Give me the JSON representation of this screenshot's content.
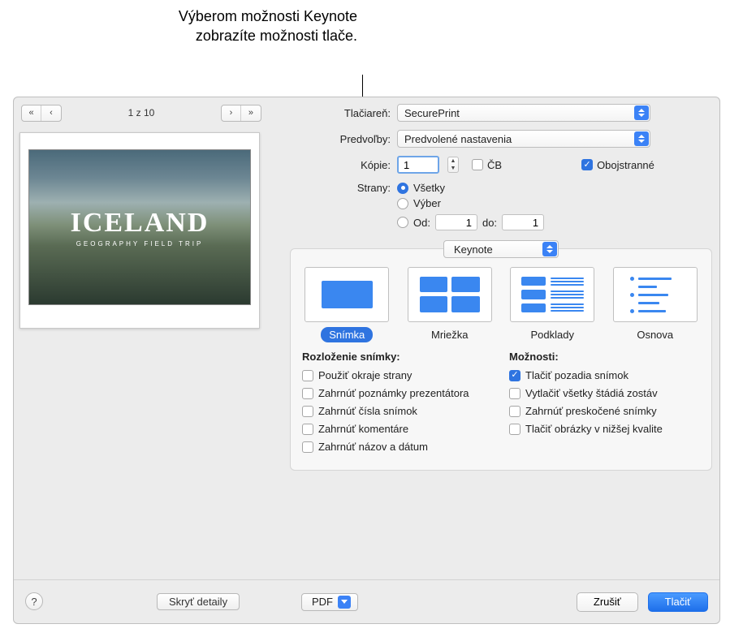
{
  "callout": {
    "text": "Výberom možnosti Keynote zobrazíte možnosti tlače."
  },
  "preview": {
    "page_indicator": "1 z 10",
    "slide_title": "ICELAND",
    "slide_subtitle": "GEOGRAPHY FIELD TRIP"
  },
  "labels": {
    "printer": "Tlačiareň:",
    "presets": "Predvoľby:",
    "copies": "Kópie:",
    "bw": "ČB",
    "two_sided": "Obojstranné",
    "pages": "Strany:",
    "pages_all": "Všetky",
    "pages_selection": "Výber",
    "pages_from": "Od:",
    "pages_to": "do:"
  },
  "values": {
    "printer": "SecurePrint",
    "presets": "Predvolené nastavenia",
    "copies": "1",
    "bw_checked": false,
    "two_sided_checked": true,
    "pages_mode": "all",
    "from_val": "1",
    "to_val": "1",
    "app_menu": "Keynote"
  },
  "layouts": {
    "slide": "Snímka",
    "grid": "Mriežka",
    "handout": "Podklady",
    "outline": "Osnova",
    "selected": "slide"
  },
  "slide_layout_section_title": "Rozloženie snímky:",
  "options_section_title": "Možnosti:",
  "layout_opts": {
    "use_margins": "Použiť okraje strany",
    "include_notes": "Zahrnúť poznámky prezentátora",
    "include_numbers": "Zahrnúť čísla snímok",
    "include_comments": "Zahrnúť komentáre",
    "include_name_date": "Zahrnúť názov a dátum"
  },
  "print_opts": {
    "print_backgrounds": {
      "label": "Tlačiť pozadia snímok",
      "checked": true
    },
    "print_builds": {
      "label": "Vytlačiť všetky štádiá zostáv",
      "checked": false
    },
    "include_skipped": {
      "label": "Zahrnúť preskočené snímky",
      "checked": false
    },
    "draft_images": {
      "label": "Tlačiť obrázky v nižšej kvalite",
      "checked": false
    }
  },
  "bottom": {
    "hide_details": "Skryť detaily",
    "pdf": "PDF",
    "cancel": "Zrušiť",
    "print": "Tlačiť"
  }
}
